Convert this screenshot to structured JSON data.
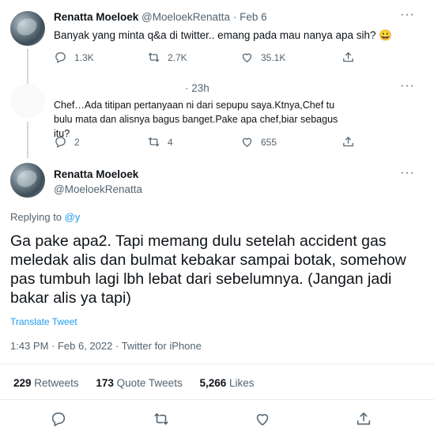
{
  "tweet1": {
    "name": "Renatta Moeloek",
    "handle": "@MoeloekRenatta",
    "sep": "·",
    "time": "Feb 6",
    "more": "···",
    "text": "Banyak yang minta q&a di twitter.. emang pada mau nanya apa sih? 😀",
    "replies": "1.3K",
    "retweets": "2.7K",
    "likes": "35.1K"
  },
  "tweet2": {
    "time": "· 23h",
    "text": "Chef…Ada titipan pertanyaan ni dari sepupu saya.Ktnya,Chef tu bulu mata dan alisnya bagus banget.Pake apa chef,biar sebagus itu?",
    "replies": "2",
    "retweets": "4",
    "likes": "655"
  },
  "main": {
    "name": "Renatta Moeloek",
    "handle": "@MoeloekRenatta",
    "more": "···",
    "replying_prefix": "Replying to ",
    "replying_to": "@y",
    "text": "Ga pake apa2. Tapi memang dulu setelah accident gas meledak alis dan bulmat kebakar sampai botak, somehow pas tumbuh lagi lbh lebat dari sebelumnya. (Jangan jadi bakar alis ya tapi)",
    "translate": "Translate Tweet",
    "meta": "1:43 PM · Feb 6, 2022 · Twitter for iPhone",
    "retweets_count": "229",
    "retweets_label": "Retweets",
    "quotes_count": "173",
    "quotes_label": "Quote Tweets",
    "likes_count": "5,266",
    "likes_label": "Likes"
  },
  "colors": {
    "link": "#1d9bf0",
    "secondary": "#536471",
    "text": "#0f1419"
  },
  "icons": [
    "reply-icon",
    "retweet-icon",
    "like-icon",
    "share-icon",
    "more-icon"
  ]
}
